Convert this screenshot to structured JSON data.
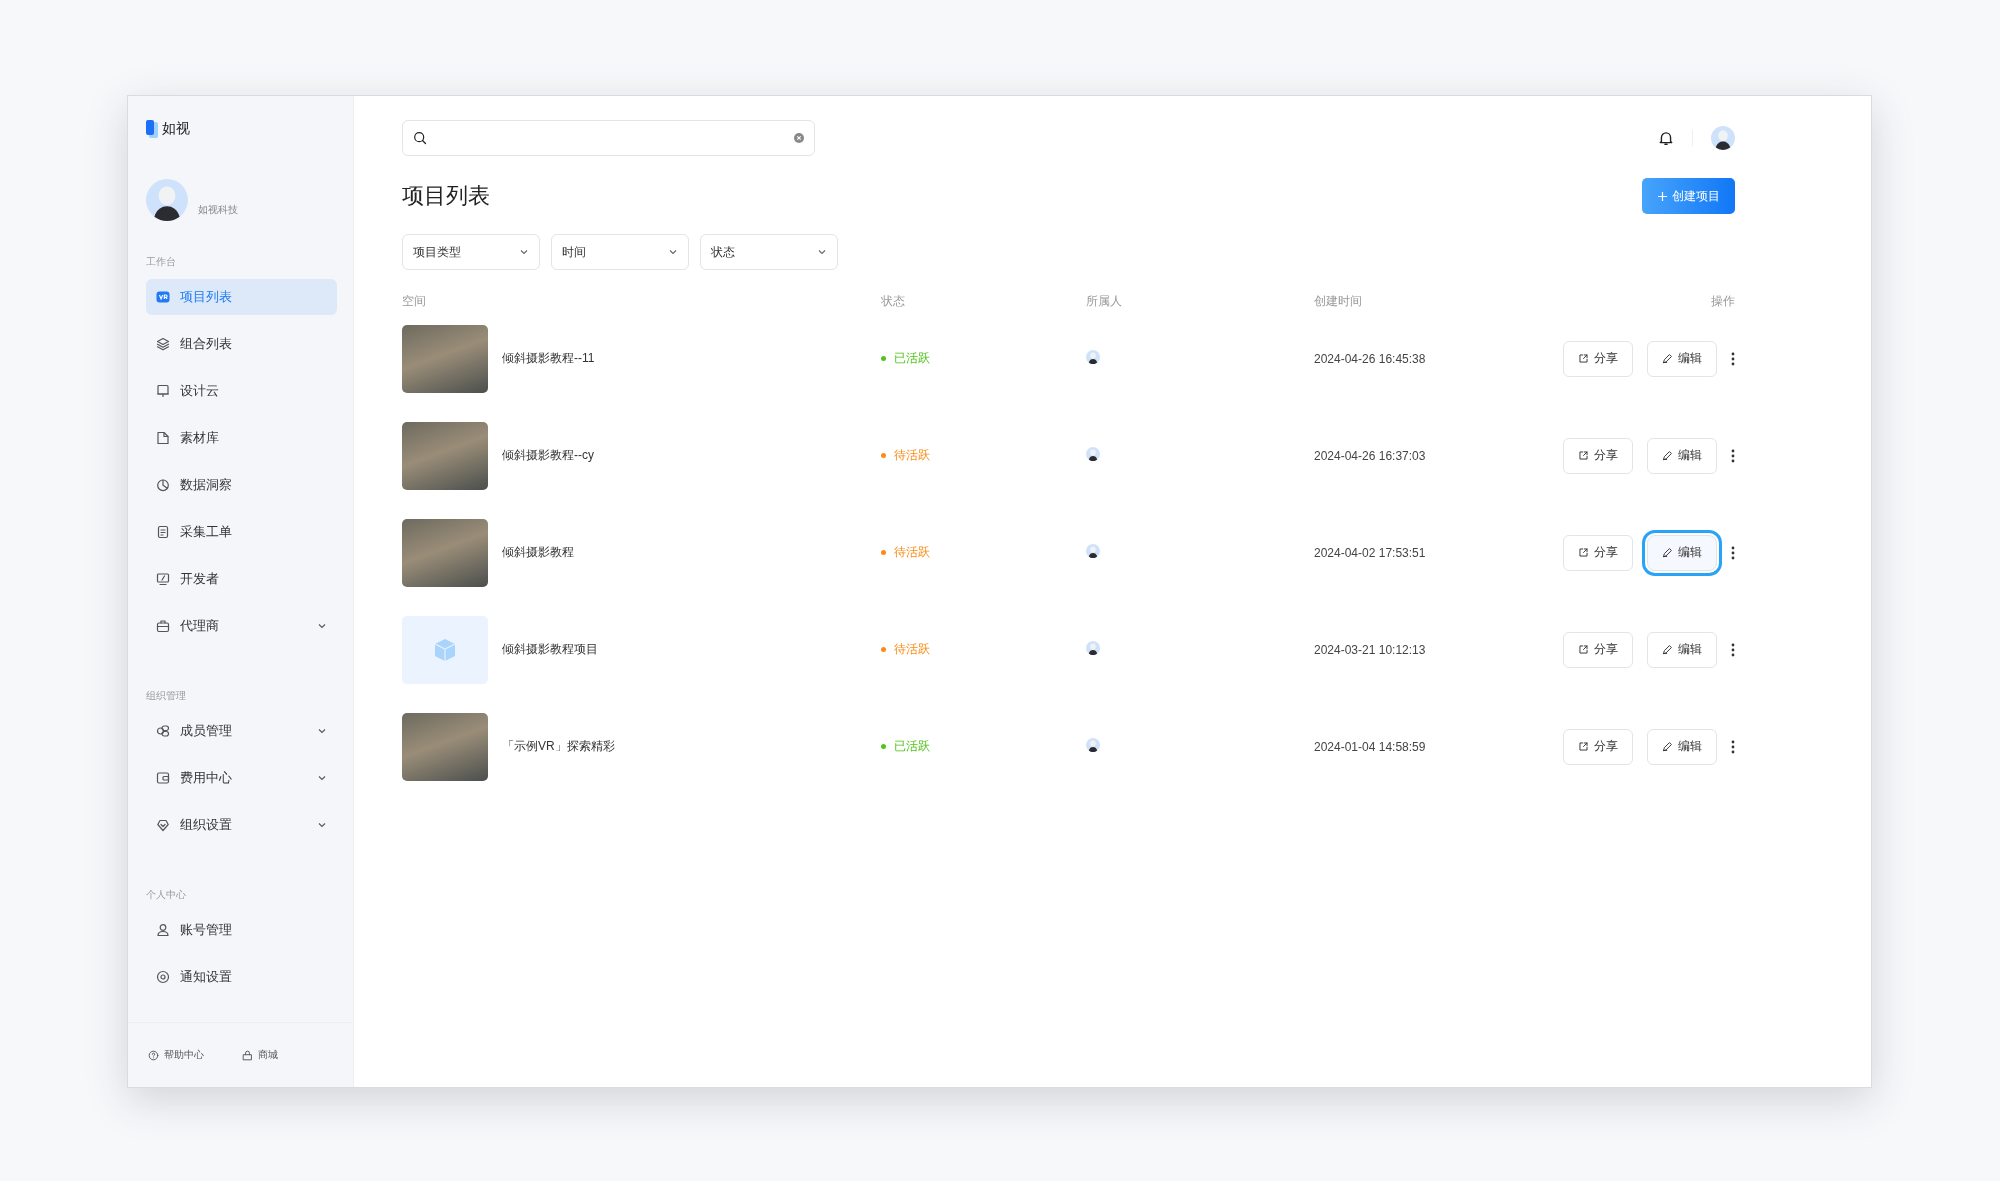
{
  "sidebar": {
    "logo": "如视",
    "org_name": "如视科技",
    "sections": [
      {
        "title": "工作台",
        "items": [
          {
            "label": "项目列表",
            "selected": true
          },
          {
            "label": "组合列表",
            "selected": false
          },
          {
            "label": "设计云",
            "selected": false
          },
          {
            "label": "素材库",
            "selected": false
          },
          {
            "label": "数据洞察",
            "selected": false
          },
          {
            "label": "采集工单",
            "selected": false
          },
          {
            "label": "开发者",
            "selected": false
          },
          {
            "label": "代理商",
            "selected": false,
            "expanded": false
          }
        ]
      },
      {
        "title": "组织管理",
        "items": [
          {
            "label": "成员管理",
            "selected": false,
            "expanded": false
          },
          {
            "label": "费用中心",
            "selected": false,
            "expanded": false
          },
          {
            "label": "组织设置",
            "selected": false,
            "expanded": false
          }
        ]
      },
      {
        "title": "个人中心",
        "items": [
          {
            "label": "账号管理",
            "selected": false
          },
          {
            "label": "通知设置",
            "selected": false
          }
        ]
      }
    ],
    "footer": [
      "帮助中心",
      "商城"
    ]
  },
  "page_title": "项目列表",
  "create_button": "创建项目",
  "filters": [
    "项目类型",
    "时间",
    "状态"
  ],
  "table": {
    "columns": [
      "空间",
      "状态",
      "所属人",
      "创建时间",
      "操作"
    ],
    "rows": [
      {
        "kind": "photo",
        "name": "倾斜摄影教程--11",
        "status": "已活跃",
        "color": "#52c41a",
        "created": "2024-04-26 16:45:38",
        "share": "分享",
        "edit": "编辑",
        "edit_focused": false
      },
      {
        "kind": "photo",
        "name": "倾斜摄影教程--cy",
        "status": "待活跃",
        "color": "#fa8c16",
        "created": "2024-04-26 16:37:03",
        "share": "分享",
        "edit": "编辑",
        "edit_focused": false
      },
      {
        "kind": "photo",
        "name": "倾斜摄影教程",
        "status": "待活跃",
        "color": "#fa8c16",
        "created": "2024-04-02 17:53:51",
        "share": "分享",
        "edit": "编辑",
        "edit_focused": true
      },
      {
        "kind": "placeholder",
        "name": "倾斜摄影教程项目",
        "status": "待活跃",
        "color": "#fa8c16",
        "created": "2024-03-21 10:12:13",
        "share": "分享",
        "edit": "编辑",
        "edit_focused": false
      },
      {
        "kind": "photo",
        "name": "「示例VR」探索精彩",
        "status": "已活跃",
        "color": "#52c41a",
        "created": "2024-01-04 14:58:59",
        "share": "分享",
        "edit": "编辑",
        "edit_focused": false
      }
    ]
  }
}
